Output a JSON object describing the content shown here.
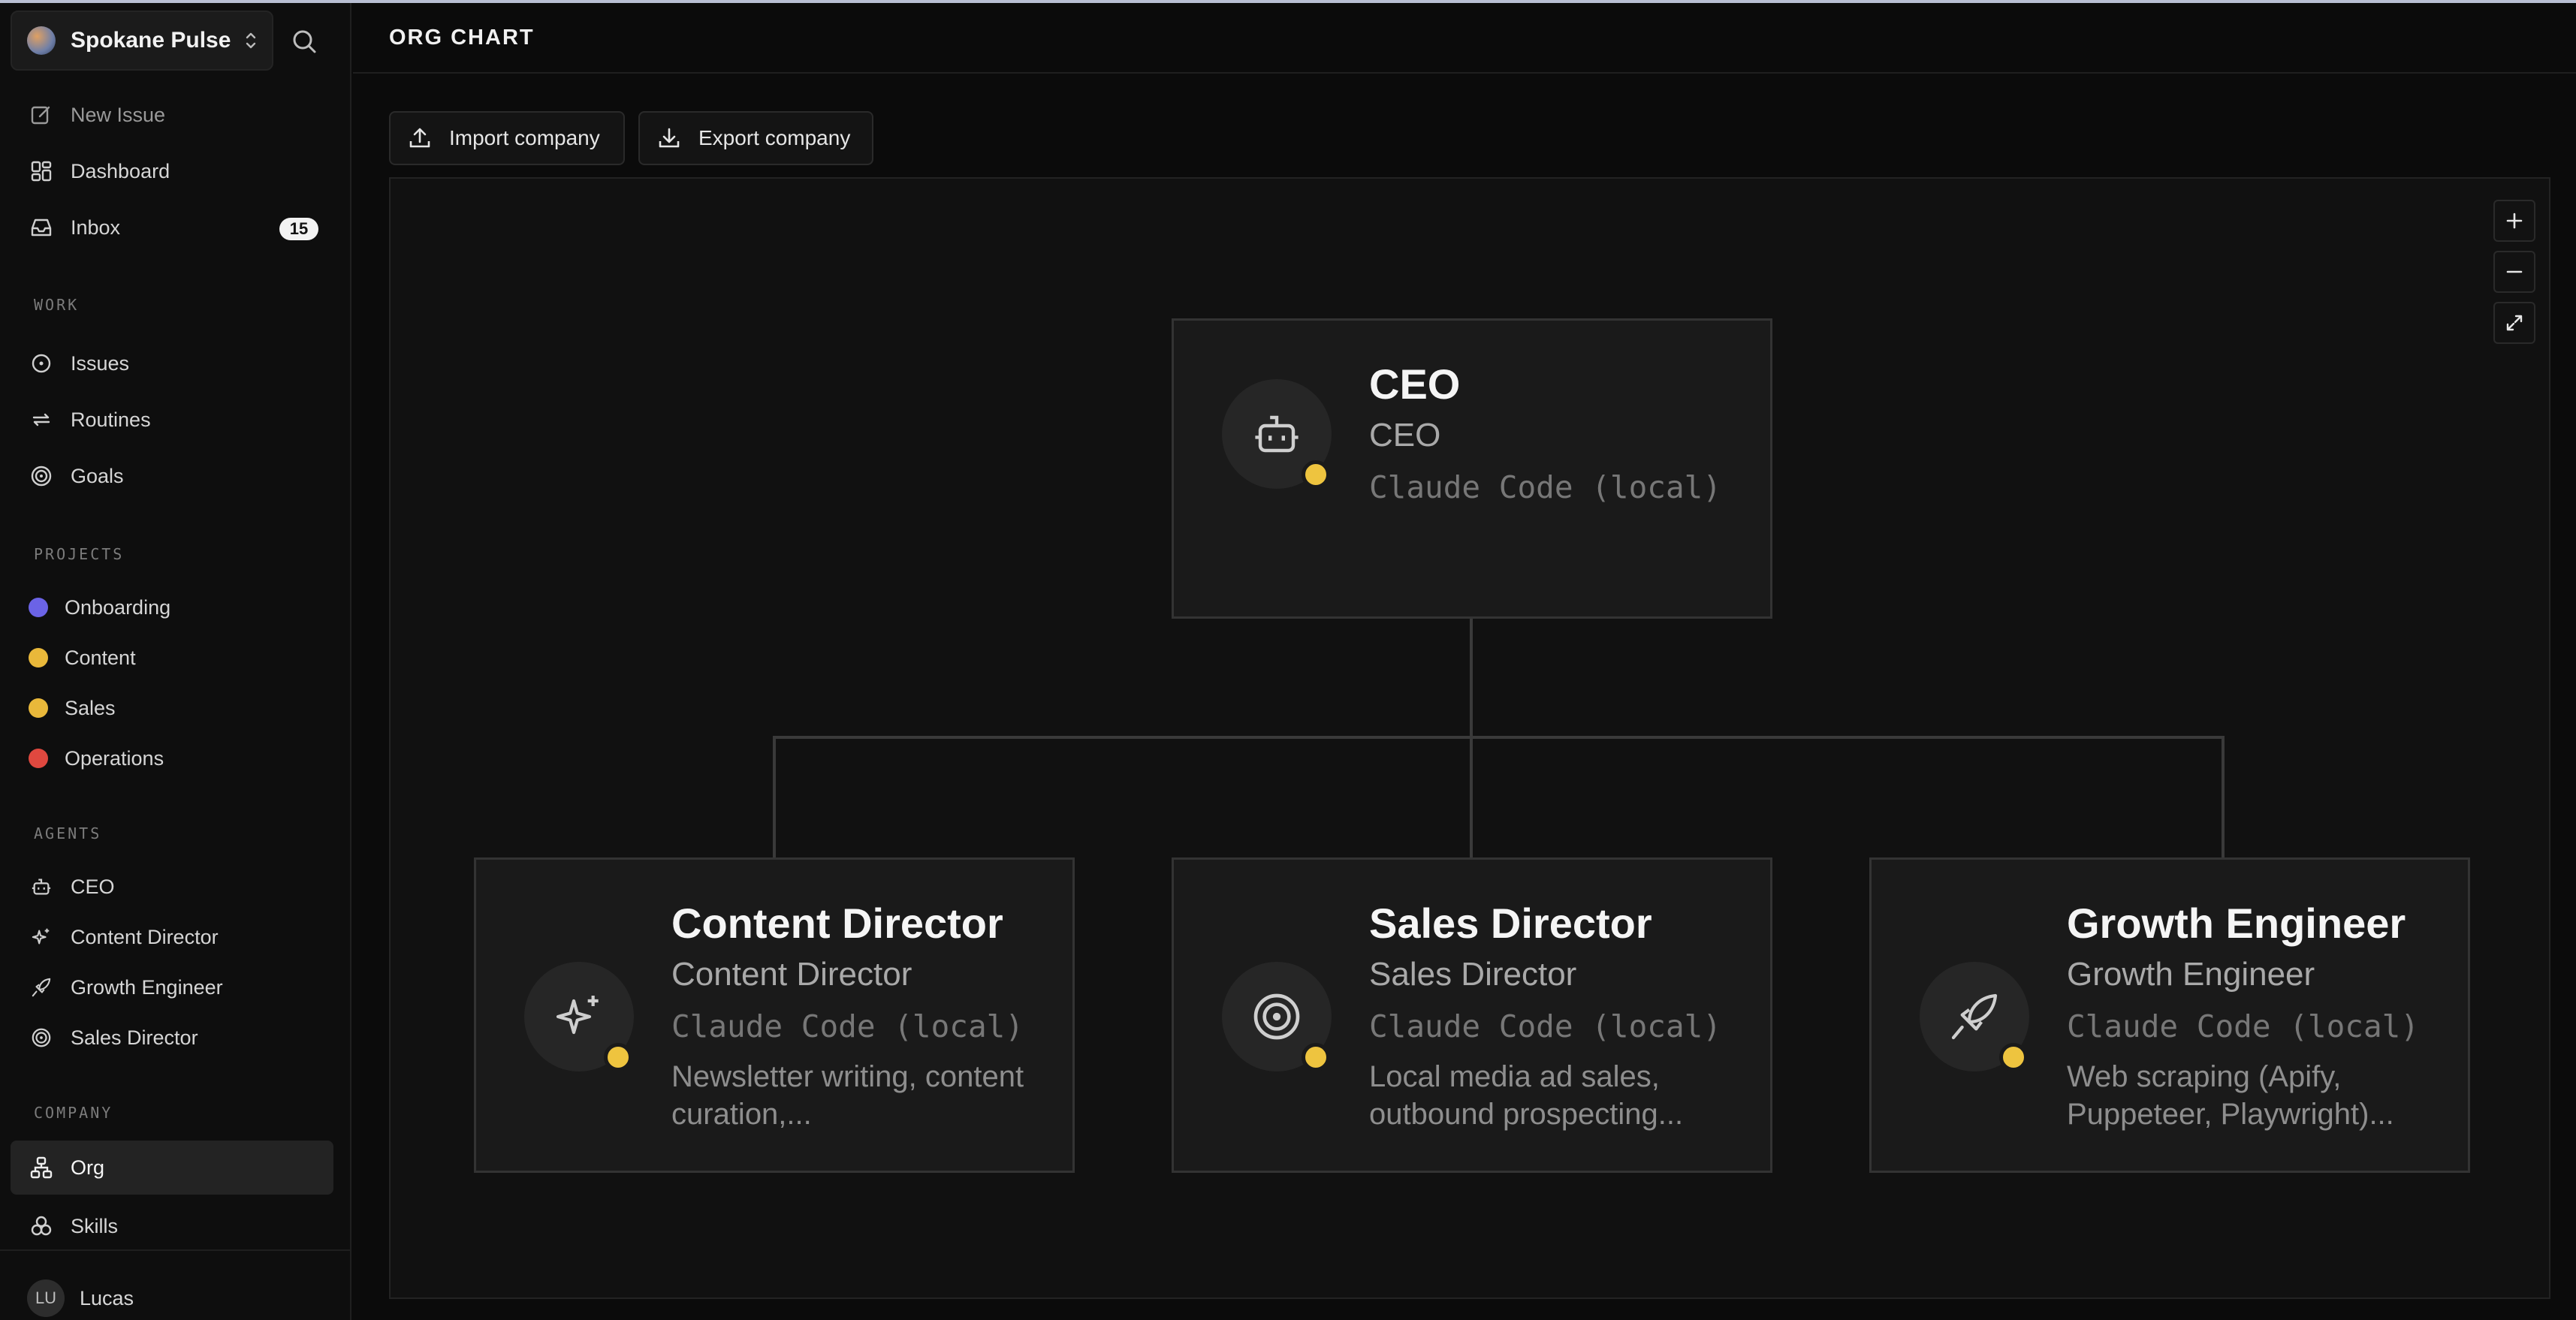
{
  "sidebar": {
    "company_name": "Spokane Pulse",
    "top_items": [
      {
        "label": "New Issue",
        "icon": "edit-icon"
      },
      {
        "label": "Dashboard",
        "icon": "dashboard-icon"
      },
      {
        "label": "Inbox",
        "icon": "inbox-icon",
        "badge": "15"
      }
    ],
    "work_label": "WORK",
    "work_items": [
      {
        "label": "Issues",
        "icon": "circle-dot-icon"
      },
      {
        "label": "Routines",
        "icon": "repeat-icon"
      },
      {
        "label": "Goals",
        "icon": "target-icon"
      }
    ],
    "projects_label": "PROJECTS",
    "projects": [
      {
        "label": "Onboarding",
        "color": "#6b63e6"
      },
      {
        "label": "Content",
        "color": "#e9b83a"
      },
      {
        "label": "Sales",
        "color": "#e9b83a"
      },
      {
        "label": "Operations",
        "color": "#e0483f"
      }
    ],
    "agents_label": "AGENTS",
    "agents": [
      {
        "label": "CEO",
        "icon": "bot-icon"
      },
      {
        "label": "Content Director",
        "icon": "sparkles-icon"
      },
      {
        "label": "Growth Engineer",
        "icon": "rocket-icon"
      },
      {
        "label": "Sales Director",
        "icon": "target-icon"
      }
    ],
    "company_label": "COMPANY",
    "company_items": [
      {
        "label": "Org",
        "icon": "org-icon",
        "active": true
      },
      {
        "label": "Skills",
        "icon": "skills-icon"
      }
    ],
    "user": {
      "initials": "LU",
      "name": "Lucas"
    }
  },
  "header": {
    "title": "ORG CHART"
  },
  "toolbar": {
    "import_label": "Import company",
    "export_label": "Export company"
  },
  "org": {
    "root": {
      "title": "CEO",
      "role": "CEO",
      "adapter": "Claude Code (local)",
      "icon": "bot-icon",
      "status_color": "#eec43f"
    },
    "children": [
      {
        "title": "Content Director",
        "role": "Content Director",
        "adapter": "Claude Code (local)",
        "desc": "Newsletter writing, content curation,...",
        "icon": "sparkles-icon"
      },
      {
        "title": "Sales Director",
        "role": "Sales Director",
        "adapter": "Claude Code (local)",
        "desc": "Local media ad sales, outbound prospecting...",
        "icon": "target-icon"
      },
      {
        "title": "Growth Engineer",
        "role": "Growth Engineer",
        "adapter": "Claude Code (local)",
        "desc": "Web scraping (Apify, Puppeteer, Playwright)...",
        "icon": "rocket-icon"
      }
    ]
  }
}
